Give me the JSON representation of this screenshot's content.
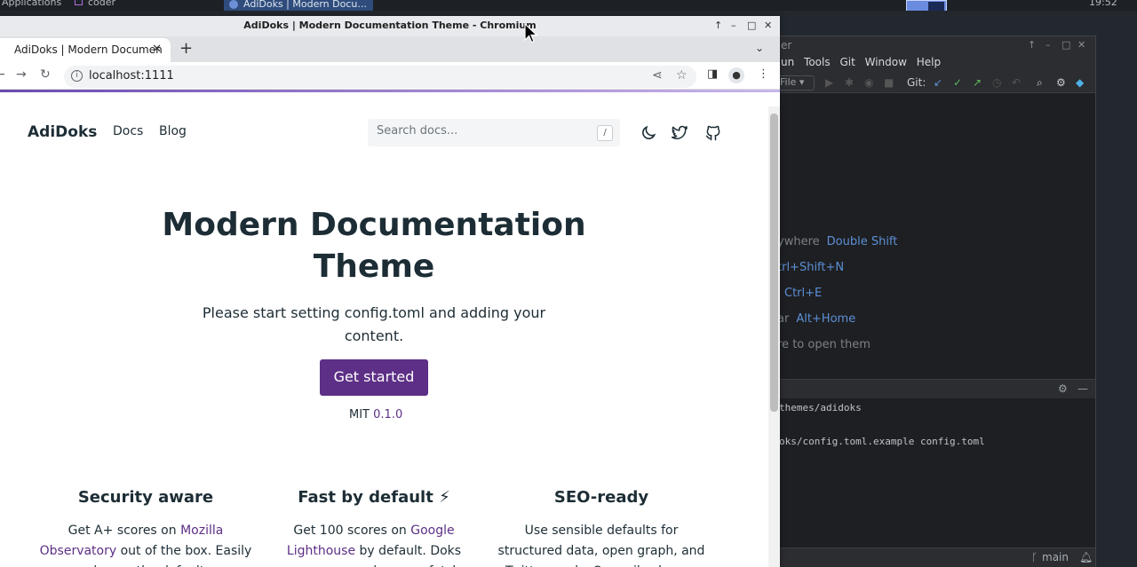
{
  "panel": {
    "applications": "Applications",
    "coder": "coder",
    "task_title": "AdiDoks | Modern Docu...",
    "clock": "19:52"
  },
  "ide": {
    "title": "er",
    "menu": [
      "un",
      "Tools",
      "Git",
      "Window",
      "Help"
    ],
    "file_btn": "File",
    "git_label": "Git:",
    "hints": [
      {
        "text": "ywhere",
        "key": "Double Shift"
      },
      {
        "text": "",
        "key": "trl+Shift+N"
      },
      {
        "text": "",
        "key": "Ctrl+E"
      },
      {
        "text": "ar",
        "key": "Alt+Home"
      },
      {
        "text": "re to open them",
        "key": ""
      }
    ],
    "terminal_lines": [
      "themes/adidoks",
      "oks/config.toml.example config.toml"
    ],
    "branch": "main"
  },
  "browser": {
    "window_title": "AdiDoks | Modern Documentation Theme - Chromium",
    "tab_title": "AdiDoks | Modern Documen",
    "url": "localhost:1111"
  },
  "site": {
    "logo": "AdiDoks",
    "nav": [
      "Docs",
      "Blog"
    ],
    "search_placeholder": "Search docs...",
    "search_kbd": "/",
    "hero_title": "Modern Documentation Theme",
    "hero_lead": "Please start setting config.toml and adding your content.",
    "cta": "Get started",
    "license": "MIT",
    "version": "0.1.0",
    "features": [
      {
        "title": "Security aware",
        "pre": "Get A+ scores on ",
        "link": "Mozilla Observatory",
        "post": " out of the box. Easily change the default"
      },
      {
        "title": "Fast by default ⚡",
        "pre": "Get 100 scores on ",
        "link": "Google Lighthouse",
        "post": " by default. Doks removes unused css, prefetches"
      },
      {
        "title": "SEO-ready",
        "pre": "",
        "link": "",
        "post": "Use sensible defaults for structured data, open graph, and Twitter cards. Or easily change"
      }
    ]
  }
}
